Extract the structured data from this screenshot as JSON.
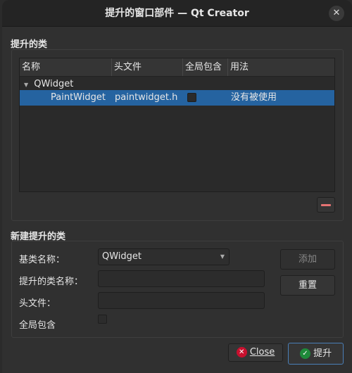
{
  "window": {
    "title": "提升的窗口部件 — Qt Creator",
    "close": "✕"
  },
  "promoted": {
    "label": "提升的类",
    "headers": [
      "名称",
      "头文件",
      "全局包含",
      "用法"
    ],
    "group": "QWidget",
    "rows": [
      {
        "name": "PaintWidget",
        "header": "paintwidget.h",
        "global": false,
        "usage": "没有被使用"
      }
    ]
  },
  "new_class": {
    "label": "新建提升的类",
    "base_label": "基类名称：",
    "base_value": "QWidget",
    "class_label": "提升的类名称：",
    "class_value": "",
    "header_label": "头文件：",
    "header_value": "",
    "global_label": "全局包含",
    "add": "添加",
    "reset": "重置"
  },
  "footer": {
    "close": "Close",
    "promote": "提升"
  }
}
